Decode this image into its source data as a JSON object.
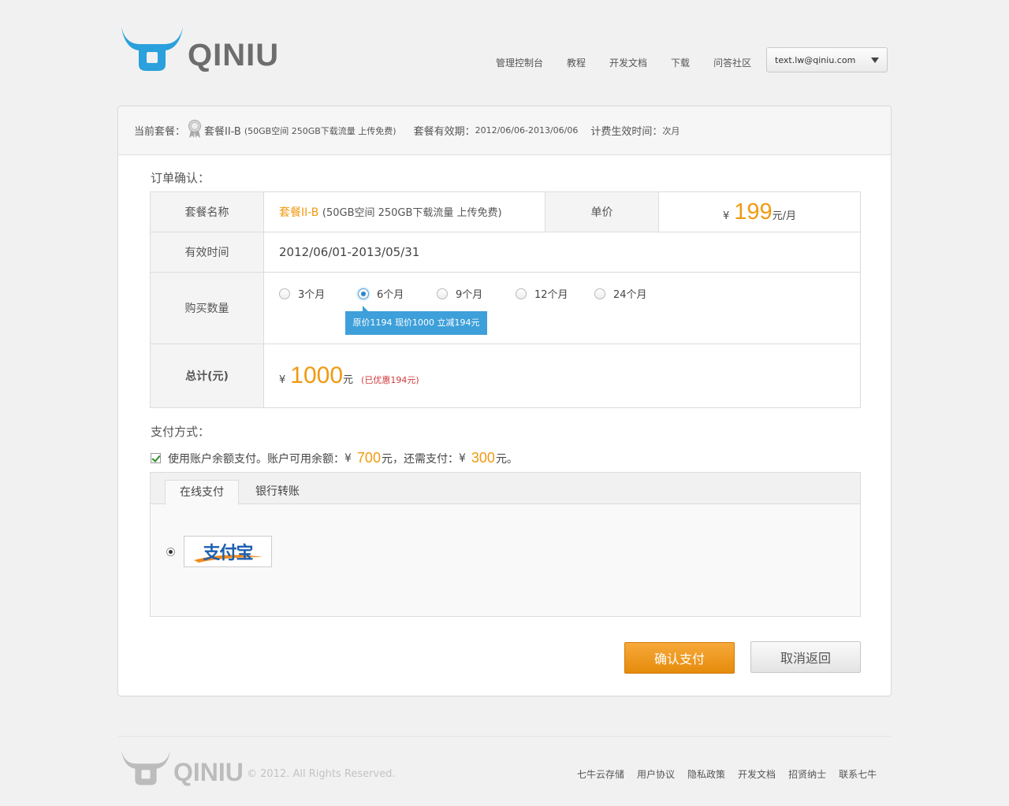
{
  "header": {
    "logo_text": "QINIU",
    "nav": [
      "管理控制台",
      "教程",
      "开发文档",
      "下载",
      "问答社区"
    ],
    "account_email": "text.lw@qiniu.com"
  },
  "plan_bar": {
    "current_label": "当前套餐：",
    "plan_name": "套餐II-B",
    "plan_desc": "(50GB空间 250GB下载流量 上传免费)",
    "valid_label": "套餐有效期：",
    "valid_value": "2012/06/06-2013/06/06",
    "billing_label": "计费生效时间：",
    "billing_value": "次月"
  },
  "order": {
    "title": "订单确认：",
    "name_label": "套餐名称",
    "name_value": "套餐II-B",
    "name_desc": "(50GB空间 250GB下载流量 上传免费)",
    "unit_price_label": "单价",
    "currency": "¥",
    "unit_price": "199",
    "unit_price_suffix": "元/月",
    "period_label": "有效时间",
    "period_value": "2012/06/01-2013/05/31",
    "quantity_label": "购买数量",
    "quantity_options": [
      "3个月",
      "6个月",
      "9个月",
      "12个月",
      "24个月"
    ],
    "quantity_selected": "6个月",
    "tooltip": "原价1194 现价1000 立减194元",
    "total_label": "总计(元)",
    "total_value": "1000",
    "total_suffix": "元",
    "discount": "(已优惠194元)"
  },
  "payment": {
    "title": "支付方式：",
    "balance_prefix": "使用账户余额支付。账户可用余额：",
    "balance_amount": "700",
    "balance_mid": "元，还需支付：",
    "remaining_amount": "300",
    "balance_suffix": "元。",
    "tabs": [
      "在线支付",
      "银行转账"
    ],
    "alipay_label": "支付宝"
  },
  "buttons": {
    "confirm": "确认支付",
    "cancel": "取消返回"
  },
  "footer": {
    "copyright": "© 2012. All Rights Reserved.",
    "links": [
      "七牛云存储",
      "用户协议",
      "隐私政策",
      "开发文档",
      "招贤纳士",
      "联系七牛"
    ]
  },
  "colors": {
    "accent_orange": "#f09a10",
    "tooltip_blue": "#3ea0da",
    "logo_blue": "#2aa0dc"
  }
}
